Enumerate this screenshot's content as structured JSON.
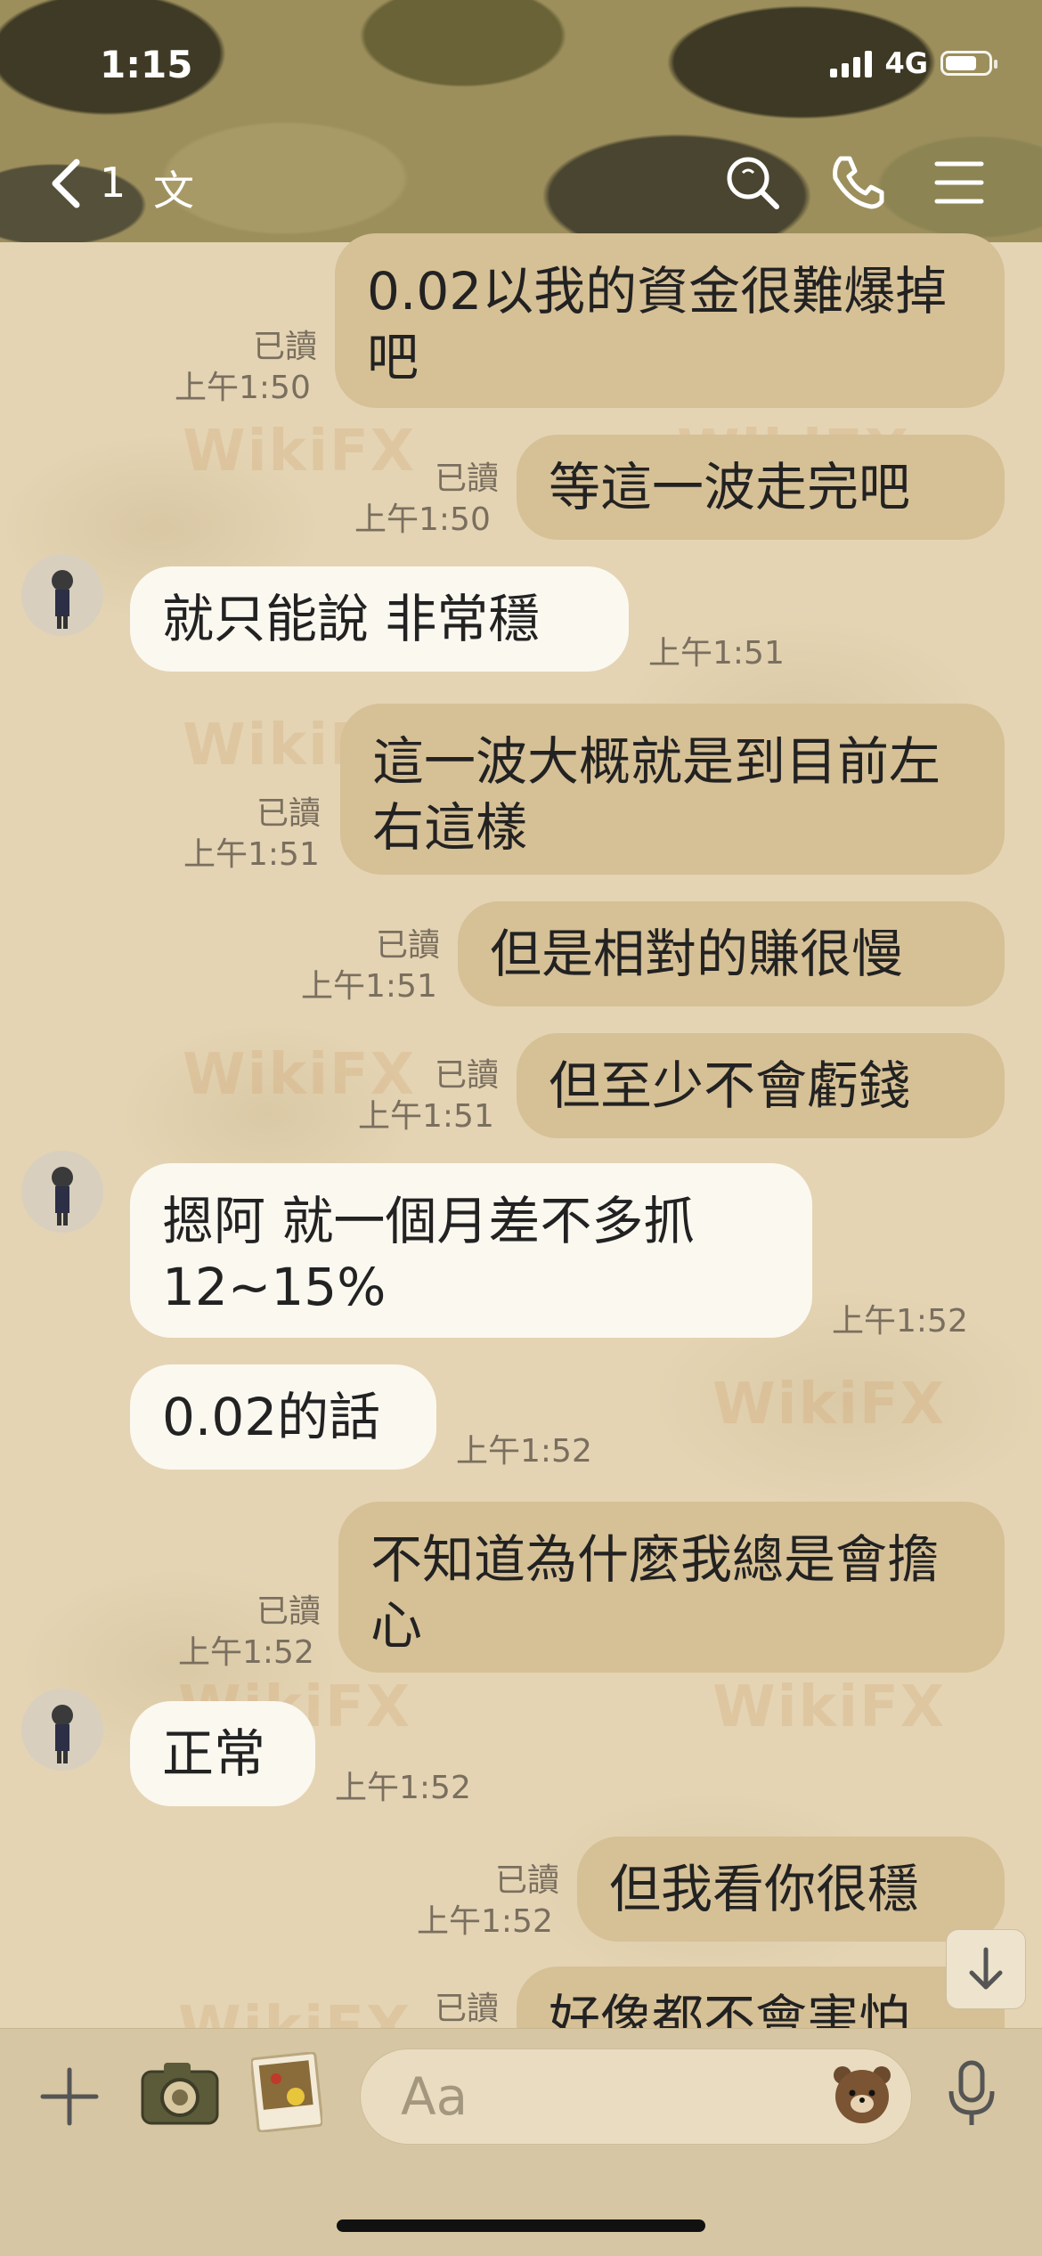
{
  "status_bar": {
    "time": "1:15",
    "network": "4G"
  },
  "nav": {
    "back_count": "1",
    "title": "文"
  },
  "read_label": "已讀",
  "messages": [
    {
      "side": "me",
      "text": "0.02以我的資金很難爆掉吧",
      "time": "上午1:50",
      "read": true
    },
    {
      "side": "me",
      "text": "等這一波走完吧",
      "time": "上午1:50",
      "read": true
    },
    {
      "side": "them",
      "text": "就只能說 非常穩",
      "time": "上午1:51"
    },
    {
      "side": "me",
      "text": "這一波大概就是到目前左右這樣",
      "time": "上午1:51",
      "read": true
    },
    {
      "side": "me",
      "text": "但是相對的賺很慢",
      "time": "上午1:51",
      "read": true
    },
    {
      "side": "me",
      "text": "但至少不會虧錢",
      "time": "上午1:51",
      "read": true
    },
    {
      "side": "them",
      "text": "摁阿 就一個月差不多抓12~15%",
      "time": "上午1:52"
    },
    {
      "side": "them",
      "text": "0.02的話",
      "time": "上午1:52"
    },
    {
      "side": "me",
      "text": "不知道為什麼我總是會擔心",
      "time": "上午1:52",
      "read": true
    },
    {
      "side": "them",
      "text": "正常",
      "time": "上午1:52"
    },
    {
      "side": "me",
      "text": "但我看你很穩",
      "time": "上午1:52",
      "read": true
    },
    {
      "side": "me",
      "text": "好像都不會害怕",
      "time": "",
      "read": true
    }
  ],
  "input": {
    "placeholder": "Aa"
  },
  "watermark": "WikiFX",
  "icons": {
    "back": "chevron-left-icon",
    "search": "search-icon",
    "call": "phone-icon",
    "menu": "menu-icon",
    "plus": "plus-icon",
    "camera": "camera-icon",
    "photo": "photo-icon",
    "sticker": "bear-sticker-icon",
    "mic": "microphone-icon",
    "scroll": "arrow-down-icon"
  },
  "colors": {
    "my_bubble": "#d6c096",
    "their_bubble": "#fbf8f0",
    "chat_bg": "#e4d4b3"
  }
}
